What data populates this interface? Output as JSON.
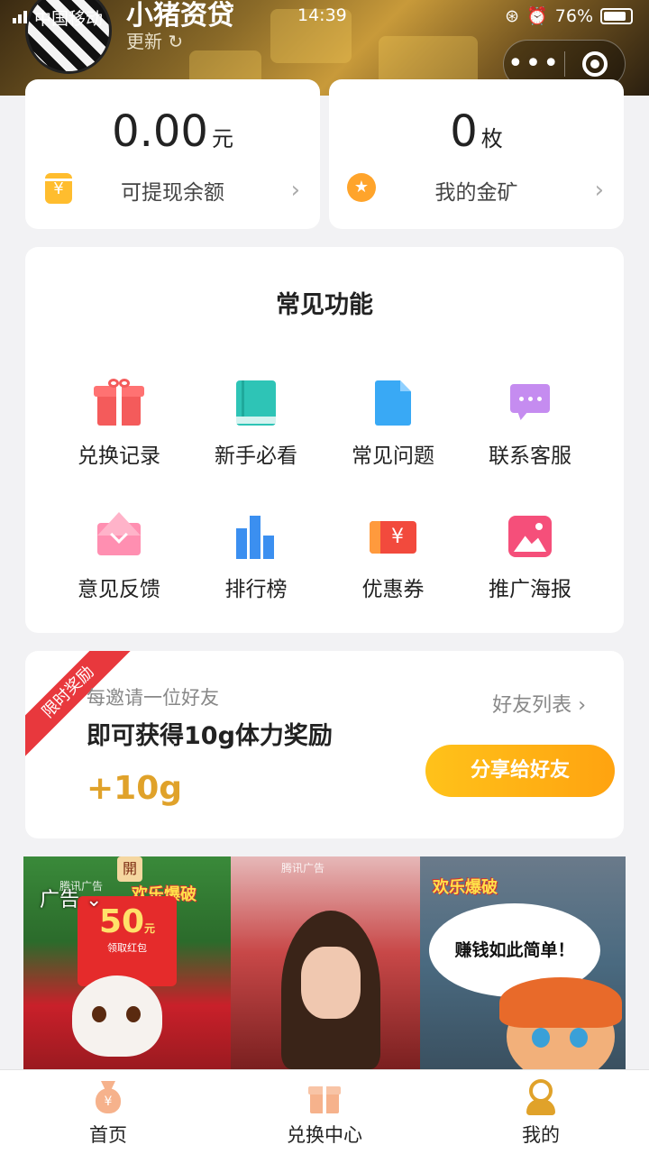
{
  "status_bar": {
    "carrier": "中国移动",
    "time": "14:39",
    "battery": "76%"
  },
  "header": {
    "title": "小猪资贷",
    "update_label": "更新"
  },
  "capsule": {
    "more": "•••",
    "close_icon": "target-icon"
  },
  "balance_card": {
    "amount": "0.00",
    "unit": "元",
    "label": "可提现余额",
    "icon": "yuan-icon"
  },
  "gold_card": {
    "amount": "0",
    "unit": "枚",
    "label": "我的金矿",
    "icon": "star-icon"
  },
  "functions": {
    "title": "常见功能",
    "items": [
      {
        "label": "兑换记录",
        "icon": "gift-icon"
      },
      {
        "label": "新手必看",
        "icon": "book-icon"
      },
      {
        "label": "常见问题",
        "icon": "document-icon"
      },
      {
        "label": "联系客服",
        "icon": "chat-icon"
      },
      {
        "label": "意见反馈",
        "icon": "envelope-icon"
      },
      {
        "label": "排行榜",
        "icon": "bar-chart-icon"
      },
      {
        "label": "优惠券",
        "icon": "coupon-icon"
      },
      {
        "label": "推广海报",
        "icon": "image-icon"
      }
    ]
  },
  "invite": {
    "ribbon": "限时奖励",
    "subtitle": "每邀请一位好友",
    "headline": "即可获得10g体力奖励",
    "reward": "+10g",
    "friend_list": "好友列表",
    "share_button": "分享给好友"
  },
  "ad": {
    "label": "广告",
    "source": "腾讯广告",
    "game_name": "欢乐爆破",
    "coupon_value": "50",
    "coupon_unit": "元",
    "coupon_action": "领取红包",
    "speech": "赚钱如此简单！",
    "tile_text": "開"
  },
  "tabbar": [
    {
      "label": "首页",
      "icon": "money-bag-icon"
    },
    {
      "label": "兑换中心",
      "icon": "gift-box-icon"
    },
    {
      "label": "我的",
      "icon": "user-icon"
    }
  ]
}
